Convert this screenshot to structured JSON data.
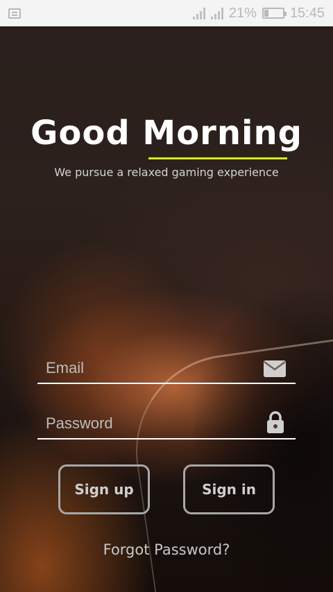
{
  "status_bar": {
    "battery": "21%",
    "time": "15:45",
    "icons": [
      "message-icon",
      "signal-icon",
      "signal-icon",
      "battery-icon"
    ]
  },
  "header": {
    "title": "Good Morning",
    "subtitle": "We pursue a relaxed gaming experience",
    "accent_color": "#d7f015"
  },
  "form": {
    "email_placeholder": "Email",
    "email_value": "",
    "email_icon": "mail-icon",
    "password_placeholder": "Password",
    "password_value": "",
    "password_icon": "lock-icon"
  },
  "actions": {
    "signup_label": "Sign up",
    "signin_label": "Sign in",
    "forgot_label": "Forgot Password?"
  }
}
